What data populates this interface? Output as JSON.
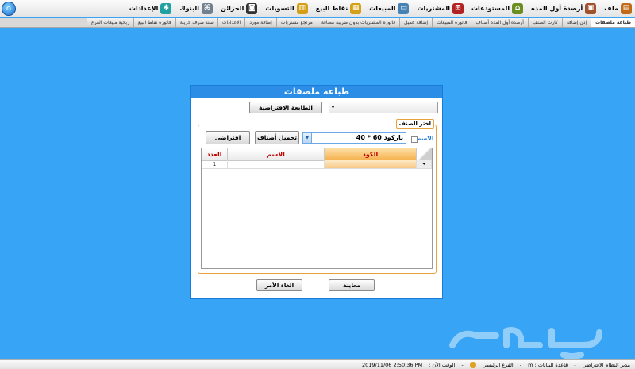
{
  "menubar": {
    "items": [
      {
        "label": "ملف",
        "icon": "file-icon",
        "color": "#c06a1a"
      },
      {
        "label": "أرصدة أول المده",
        "icon": "opening-balance-icon",
        "color": "#a0522d"
      },
      {
        "label": "المستودعات",
        "icon": "warehouse-icon",
        "color": "#6b8e23"
      },
      {
        "label": "المشتريات",
        "icon": "cart-icon",
        "color": "#b22222"
      },
      {
        "label": "المبيعات",
        "icon": "monitor-icon",
        "color": "#4682b4"
      },
      {
        "label": "نقاط البيع",
        "icon": "pos-icon",
        "color": "#d4a017"
      },
      {
        "label": "التسويات",
        "icon": "adjustments-icon",
        "color": "#d4a017"
      },
      {
        "label": "الخزائن",
        "icon": "safe-icon",
        "color": "#333333"
      },
      {
        "label": "البنوك",
        "icon": "bank-icon",
        "color": "#708090"
      },
      {
        "label": "الإعدادات",
        "icon": "settings-icon",
        "color": "#20a0a0"
      }
    ]
  },
  "tabs": [
    {
      "label": "طباعة ملصقات",
      "active": true
    },
    {
      "label": "إذن إضافة"
    },
    {
      "label": "كارت الصنف"
    },
    {
      "label": "أرصدة أول المدة أصناف"
    },
    {
      "label": "فاتورة المبيعات"
    },
    {
      "label": "إضافة عميل"
    },
    {
      "label": "فاتورة المشتريات بدون ضريبة مضافة"
    },
    {
      "label": "مرتجع مشتريات"
    },
    {
      "label": "إضافة مورد"
    },
    {
      "label": "الاعدادات"
    },
    {
      "label": "سند صرف خزينة"
    },
    {
      "label": "فاتورة نقاط البيع"
    },
    {
      "label": "ربحية مبيعات الفرع"
    }
  ],
  "dialog": {
    "title": "طباعة ملصقات",
    "default_printer_button": "الطابعة الافتراضية",
    "printer_value": "",
    "group_caption": "اختر الصنف",
    "name_label": "الاسم",
    "item_value": "باركود 60 * 40",
    "load_items_button": "تحميل أصناف",
    "default_button": "افتراضى",
    "grid": {
      "columns": {
        "code": "الكود",
        "name": "الاسم",
        "count": "العدد"
      },
      "rows": [
        {
          "code": "",
          "name": "",
          "count": "1"
        }
      ]
    },
    "preview_button": "معاينة",
    "cancel_button": "الغاء الأمر"
  },
  "statusbar": {
    "user": "مدير النظام الافتراضي",
    "database": "قاعدة البيانات : m",
    "branch": "الفرع الرئيسي",
    "time_label": "الوقت الآن :",
    "time_value": "2019/11/06 2:50:36 PM"
  },
  "watermark": {
    "text": "حراج"
  },
  "colors": {
    "background": "#37a4f5",
    "dialog_title": "#2b8de6",
    "group_border": "#e8a23c",
    "grid_header_text": "#c00000"
  }
}
